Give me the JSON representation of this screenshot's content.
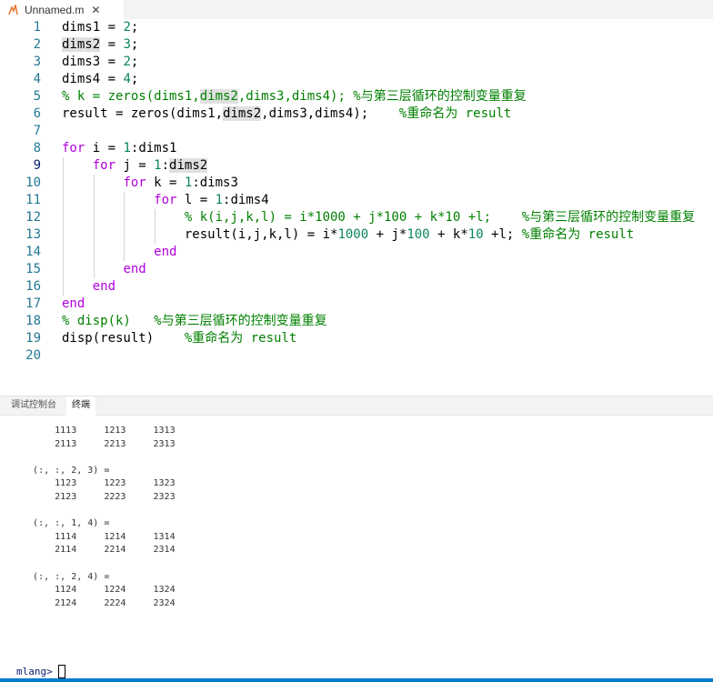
{
  "tab": {
    "filename": "Unnamed.m",
    "close_glyph": "✕"
  },
  "editor": {
    "current_line": "9",
    "lines": [
      {
        "n": "1",
        "tokens": [
          {
            "t": "dims1 = ",
            "c": ""
          },
          {
            "t": "2",
            "c": "num"
          },
          {
            "t": ";",
            "c": ""
          }
        ]
      },
      {
        "n": "2",
        "tokens": [
          {
            "t": "dims2",
            "c": "hl"
          },
          {
            "t": " = ",
            "c": ""
          },
          {
            "t": "3",
            "c": "num"
          },
          {
            "t": ";",
            "c": ""
          }
        ]
      },
      {
        "n": "3",
        "tokens": [
          {
            "t": "dims3 = ",
            "c": ""
          },
          {
            "t": "2",
            "c": "num"
          },
          {
            "t": ";",
            "c": ""
          }
        ]
      },
      {
        "n": "4",
        "tokens": [
          {
            "t": "dims4 = ",
            "c": ""
          },
          {
            "t": "4",
            "c": "num"
          },
          {
            "t": ";",
            "c": ""
          }
        ]
      },
      {
        "n": "5",
        "tokens": [
          {
            "t": "% k = zeros(dims1,",
            "c": "cm"
          },
          {
            "t": "dims2",
            "c": "cm hl"
          },
          {
            "t": ",dims3,dims4); %与第三层循环的控制变量重复",
            "c": "cm"
          }
        ]
      },
      {
        "n": "6",
        "tokens": [
          {
            "t": "result = zeros(dims1,",
            "c": ""
          },
          {
            "t": "dims2",
            "c": "hl"
          },
          {
            "t": ",dims3,dims4);    ",
            "c": ""
          },
          {
            "t": "%重命名为 result",
            "c": "cm"
          }
        ]
      },
      {
        "n": "7",
        "tokens": []
      },
      {
        "n": "8",
        "tokens": [
          {
            "t": "for",
            "c": "kw"
          },
          {
            "t": " i = ",
            "c": ""
          },
          {
            "t": "1",
            "c": "num"
          },
          {
            "t": ":dims1",
            "c": ""
          }
        ]
      },
      {
        "n": "9",
        "tokens": [
          {
            "t": "    ",
            "c": ""
          },
          {
            "t": "for",
            "c": "kw"
          },
          {
            "t": " j = ",
            "c": ""
          },
          {
            "t": "1",
            "c": "num"
          },
          {
            "t": ":",
            "c": ""
          },
          {
            "t": "dims2",
            "c": "hl"
          }
        ]
      },
      {
        "n": "10",
        "tokens": [
          {
            "t": "        ",
            "c": ""
          },
          {
            "t": "for",
            "c": "kw"
          },
          {
            "t": " k = ",
            "c": ""
          },
          {
            "t": "1",
            "c": "num"
          },
          {
            "t": ":dims3",
            "c": ""
          }
        ]
      },
      {
        "n": "11",
        "tokens": [
          {
            "t": "            ",
            "c": ""
          },
          {
            "t": "for",
            "c": "kw"
          },
          {
            "t": " l = ",
            "c": ""
          },
          {
            "t": "1",
            "c": "num"
          },
          {
            "t": ":dims4",
            "c": ""
          }
        ]
      },
      {
        "n": "12",
        "tokens": [
          {
            "t": "                ",
            "c": ""
          },
          {
            "t": "% k(i,j,k,l) = i*1000 + j*100 + k*10 +l;    %与第三层循环的控制变量重复",
            "c": "cm"
          }
        ]
      },
      {
        "n": "13",
        "tokens": [
          {
            "t": "                result(i,j,k,l) = i*",
            "c": ""
          },
          {
            "t": "1000",
            "c": "num"
          },
          {
            "t": " + j*",
            "c": ""
          },
          {
            "t": "100",
            "c": "num"
          },
          {
            "t": " + k*",
            "c": ""
          },
          {
            "t": "10",
            "c": "num"
          },
          {
            "t": " +l; ",
            "c": ""
          },
          {
            "t": "%重命名为 result",
            "c": "cm"
          }
        ]
      },
      {
        "n": "14",
        "tokens": [
          {
            "t": "            ",
            "c": ""
          },
          {
            "t": "end",
            "c": "kw"
          }
        ]
      },
      {
        "n": "15",
        "tokens": [
          {
            "t": "        ",
            "c": ""
          },
          {
            "t": "end",
            "c": "kw"
          }
        ]
      },
      {
        "n": "16",
        "tokens": [
          {
            "t": "    ",
            "c": ""
          },
          {
            "t": "end",
            "c": "kw"
          }
        ]
      },
      {
        "n": "17",
        "tokens": [
          {
            "t": "end",
            "c": "kw"
          }
        ]
      },
      {
        "n": "18",
        "tokens": [
          {
            "t": "% disp(k)   %与第三层循环的控制变量重复",
            "c": "cm"
          }
        ]
      },
      {
        "n": "19",
        "tokens": [
          {
            "t": "disp(result)    ",
            "c": ""
          },
          {
            "t": "%重命名为 result",
            "c": "cm"
          }
        ]
      },
      {
        "n": "20",
        "tokens": []
      }
    ]
  },
  "panel": {
    "tabs": [
      {
        "label": "调试控制台",
        "active": false
      },
      {
        "label": "终端",
        "active": true
      }
    ]
  },
  "terminal": {
    "lines": [
      "       1113     1213     1313",
      "       2113     2213     2313",
      "",
      "   (:, :, 2, 3) =",
      "       1123     1223     1323",
      "       2123     2223     2323",
      "",
      "   (:, :, 1, 4) =",
      "       1114     1214     1314",
      "       2114     2214     2314",
      "",
      "   (:, :, 2, 4) =",
      "       1124     1224     1324",
      "       2124     2224     2324"
    ],
    "prompt": "mlang>"
  },
  "colors": {
    "keyword": "#af00db",
    "number": "#098658",
    "comment": "#008000",
    "line_number": "#237893",
    "accent": "#007acc"
  }
}
